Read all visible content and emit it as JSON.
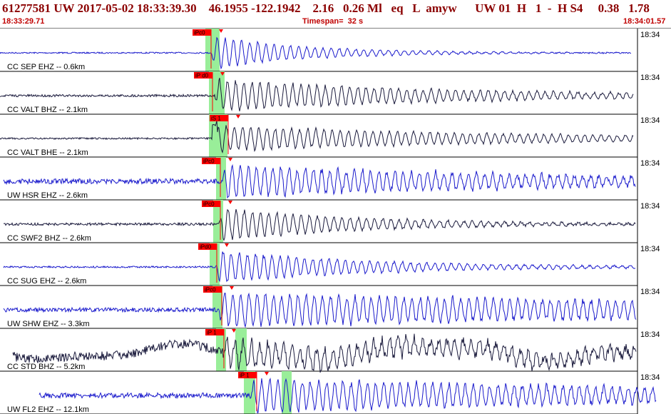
{
  "header": {
    "title": "61277581 UW 2017-05-02 18:33:39.30    46.1955 -122.1942    2.16   0.26 Ml   eq   L  amyw      UW 01  H   1  -  H S4     0.38   1.78",
    "start_time": "18:33:29.71",
    "timespan": "Timespan=  32 s",
    "end_time": "18:34:01.57"
  },
  "colors": {
    "title": "#8b0000",
    "subbar": "#c00000",
    "trace_blue": "#1a1acc",
    "trace_dark": "#1a1a3c",
    "pick_green": "#99ee99",
    "pick_flag": "#ff0000",
    "divider": "#000000"
  },
  "traces": [
    {
      "label": "CC SEP EHZ -- 0.6km",
      "time": "18:34",
      "pick": "iPc0",
      "color": "blue",
      "noise": 0.08,
      "amp": 1.0,
      "decay": 0.9,
      "onset": 0,
      "wave": 0
    },
    {
      "label": "CC VALT BHZ -- 2.1km",
      "time": "18:34",
      "pick": "iP d0",
      "color": "dark",
      "noise": 0.14,
      "amp": 0.95,
      "decay": 0.35,
      "onset": 0,
      "wave": 0
    },
    {
      "label": "CC VALT BHE -- 2.1km",
      "time": "18:34",
      "pick": "iS 1",
      "color": "dark",
      "noise": 0.1,
      "amp": 0.8,
      "decay": 0.3,
      "onset": 1,
      "wave": 0
    },
    {
      "label": "UW HSR EHZ -- 2.6km",
      "time": "18:34",
      "pick": "iPc0",
      "color": "blue",
      "noise": 0.3,
      "amp": 1.0,
      "decay": 0.25,
      "onset": 0,
      "wave": 0
    },
    {
      "label": "CC SWF2 BHZ -- 2.6km",
      "time": "18:34",
      "pick": "iPc0",
      "color": "dark",
      "noise": 0.15,
      "amp": 1.0,
      "decay": 0.6,
      "onset": 0,
      "wave": 0
    },
    {
      "label": "CC SUG EHZ -- 2.6km",
      "time": "18:34",
      "pick": "iPd0",
      "color": "blue",
      "noise": 0.1,
      "amp": 1.0,
      "decay": 0.55,
      "onset": 0,
      "wave": 0
    },
    {
      "label": "UW SHW EHZ -- 3.3km",
      "time": "18:34",
      "pick": "iPc0",
      "color": "blue",
      "noise": 0.25,
      "amp": 1.0,
      "decay": 0.12,
      "onset": 0,
      "wave": 0
    },
    {
      "label": "CC STD BHZ -- 5.2km",
      "time": "18:34",
      "pick": "iP 1",
      "color": "dark",
      "noise": 0.55,
      "amp": 0.8,
      "decay": 0.2,
      "onset": 0,
      "wave": 1
    },
    {
      "label": "UW FL2 EHZ -- 12.1km",
      "time": "18:34",
      "pick": "iP 1",
      "color": "blue",
      "noise": 0.3,
      "amp": 1.0,
      "decay": 0.15,
      "onset": 0,
      "wave": 0
    }
  ]
}
